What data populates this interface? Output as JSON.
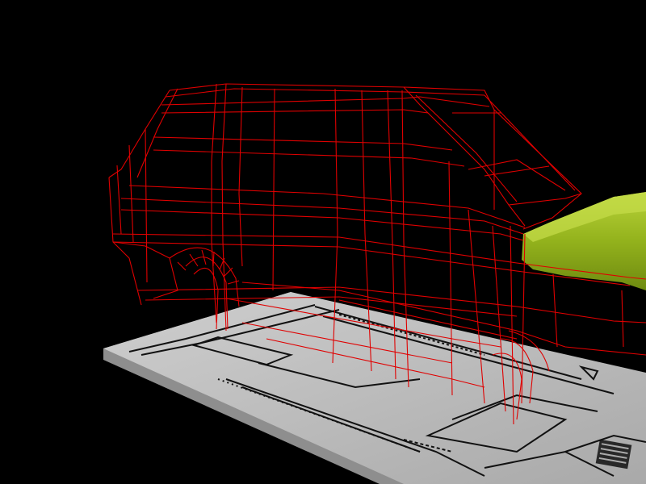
{
  "viewport": {
    "view_name": "",
    "background_color": "#000000"
  },
  "scene": {
    "wireframe_object": {
      "kind": "car-body-mesh",
      "render_mode": "wireframe",
      "color": "#e00000"
    },
    "shaded_object": {
      "kind": "hood-panel",
      "render_mode": "shaded",
      "color": "#9fbf1f"
    },
    "ground_plane": {
      "kind": "blueprint-plane",
      "render_mode": "shaded",
      "color": "#bdbdbd"
    }
  }
}
